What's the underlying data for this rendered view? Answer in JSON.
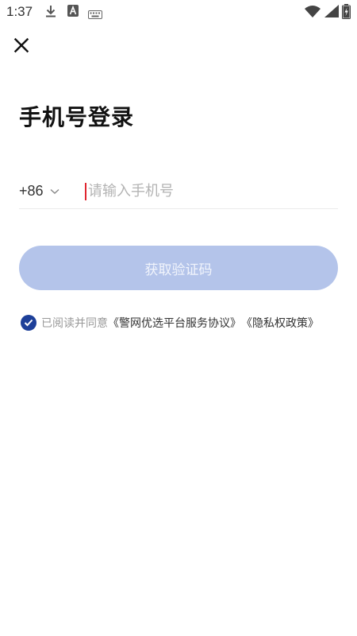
{
  "status_bar": {
    "time": "1:37",
    "icons": [
      "download-icon",
      "a-icon",
      "keyboard-icon",
      "wifi-icon",
      "signal-icon",
      "battery-icon"
    ]
  },
  "close_icon": "close-icon",
  "title": "手机号登录",
  "phone": {
    "country_code": "+86",
    "placeholder": "请输入手机号",
    "value": ""
  },
  "get_code_button": "获取验证码",
  "agreement": {
    "checked": true,
    "prefix": "已阅读并同意",
    "service_link": "《警网优选平台服务协议》",
    "privacy_link": "《隐私权政策》"
  },
  "colors": {
    "accent": "#1d3f99",
    "button_disabled": "#b4c4ea",
    "caret": "#e0262f",
    "placeholder": "#b3b3b3"
  }
}
